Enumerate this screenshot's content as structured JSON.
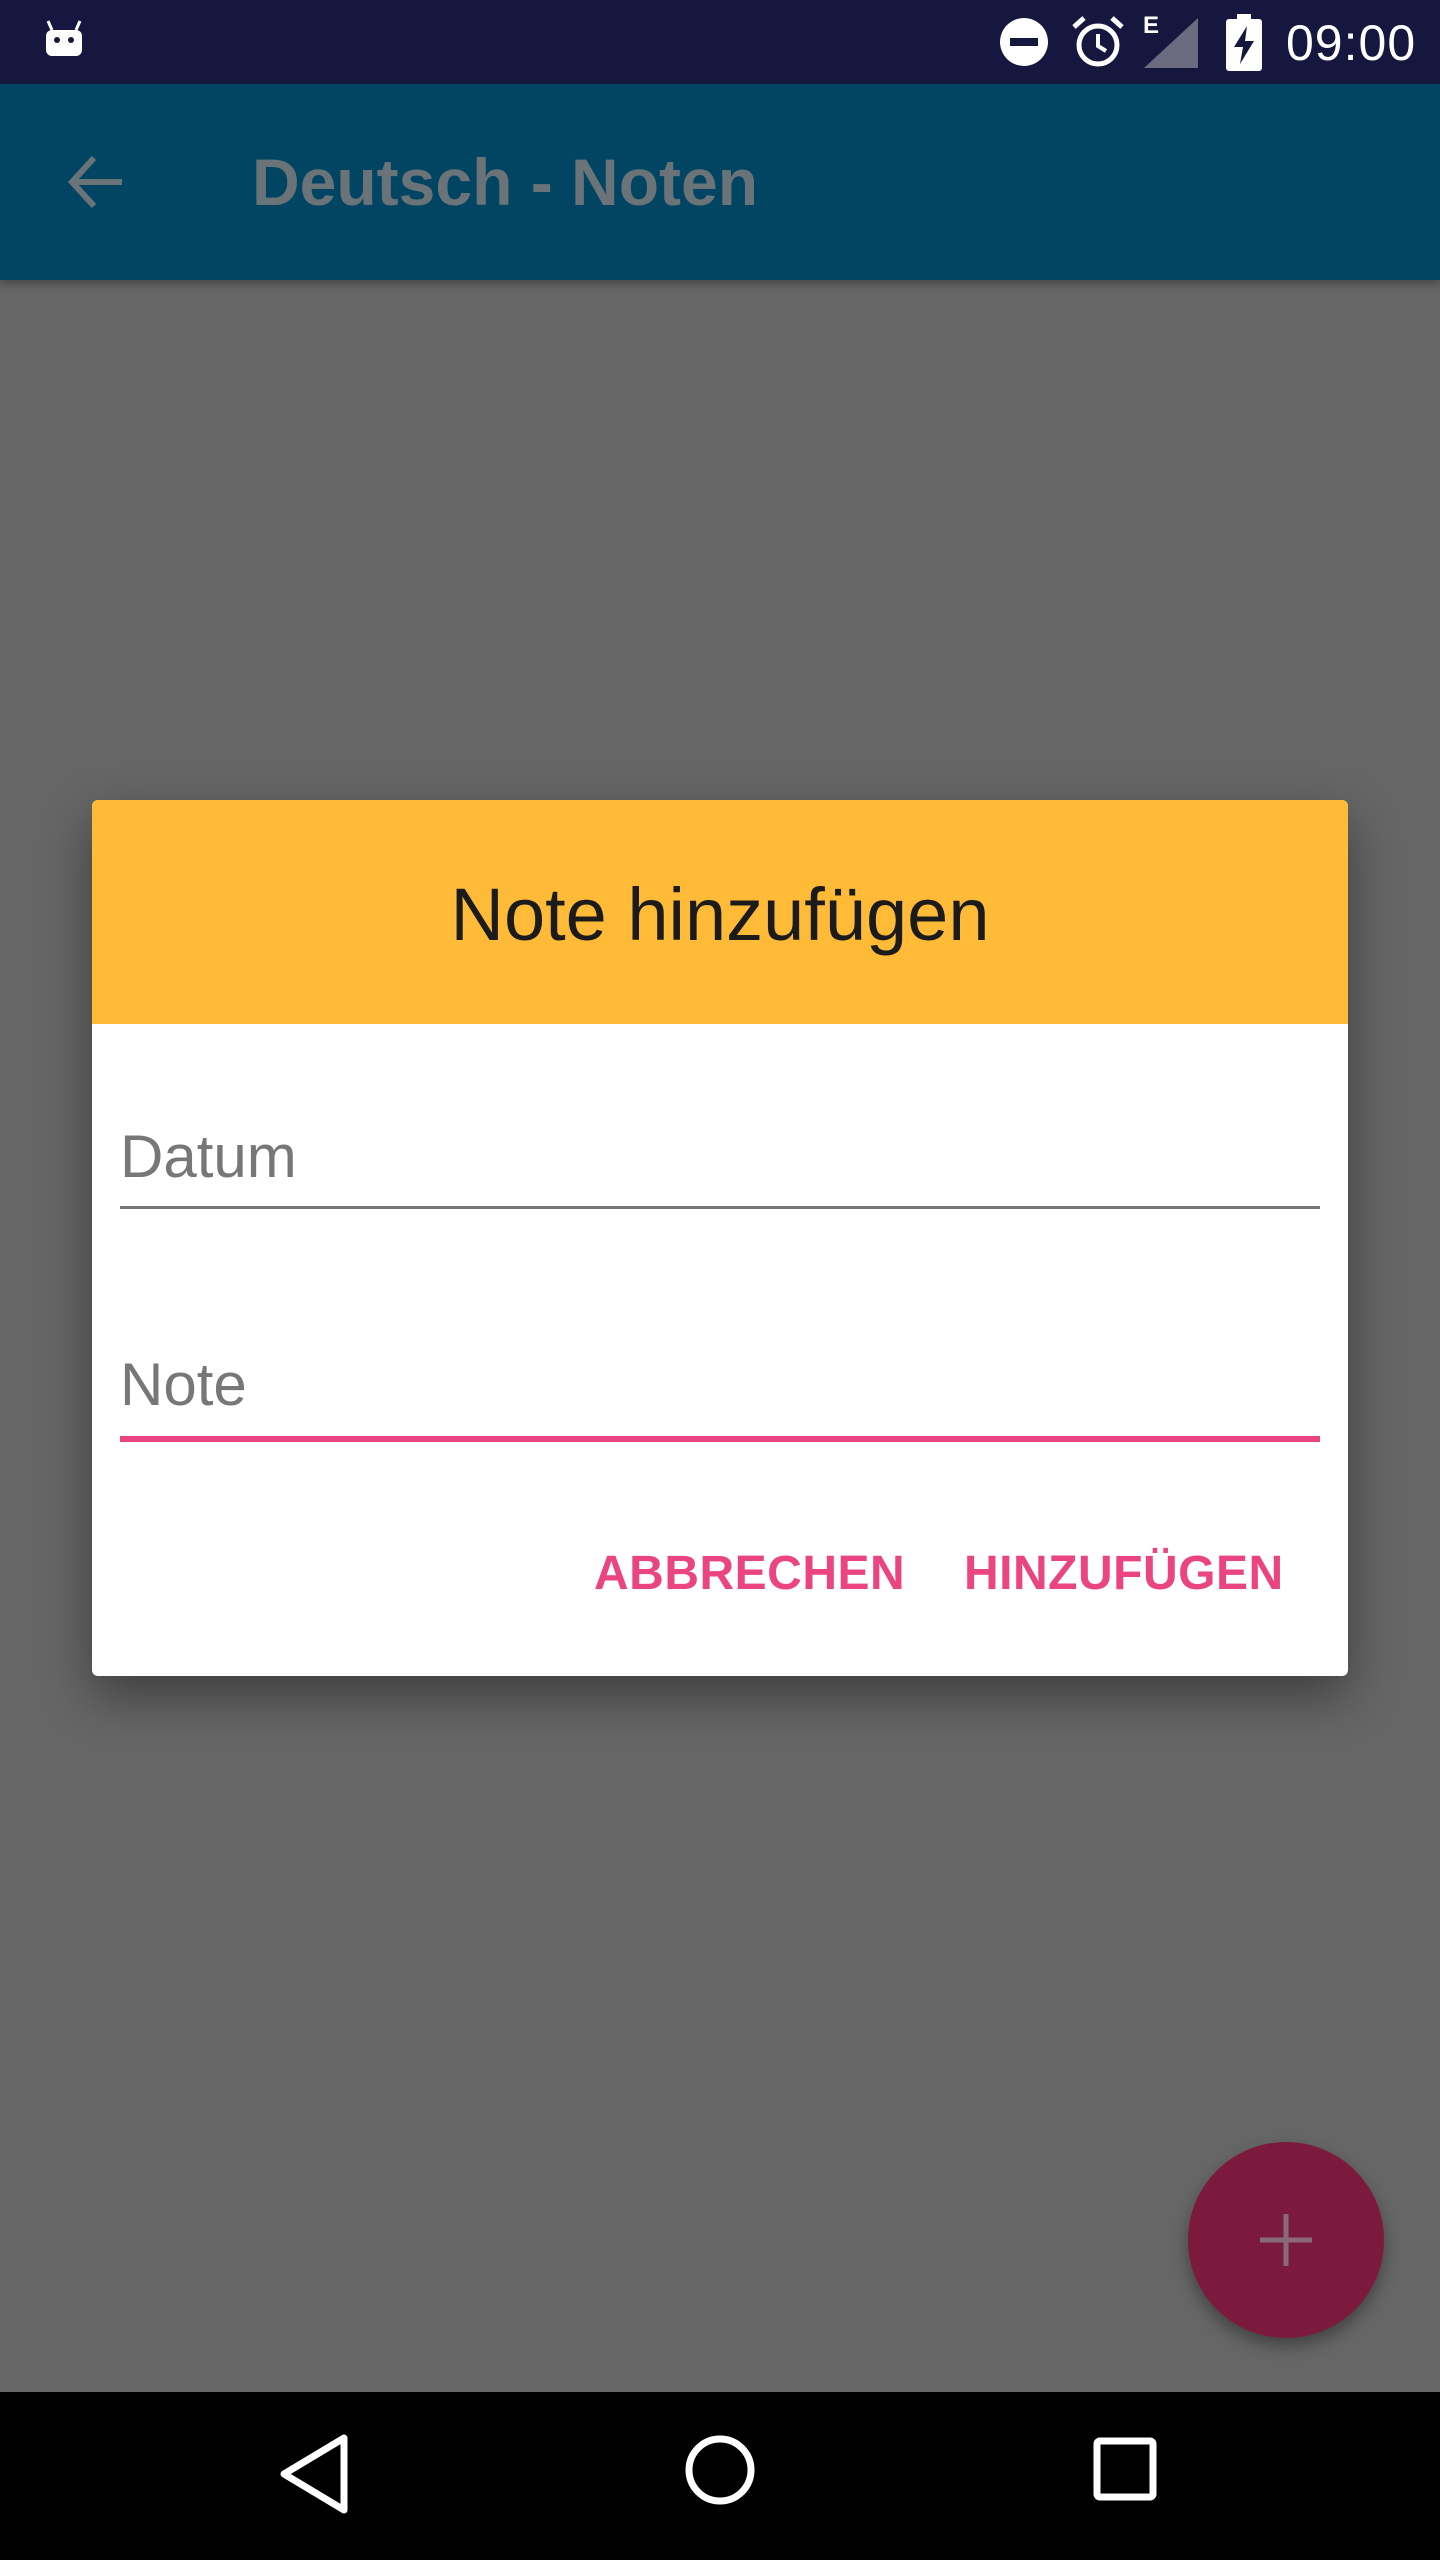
{
  "status_bar": {
    "network_type": "E",
    "time": "09:00",
    "icons": [
      "android-icon",
      "do-not-disturb-icon",
      "alarm-icon",
      "signal-icon",
      "battery-charging-icon"
    ]
  },
  "app_bar": {
    "title": "Deutsch - Noten",
    "back_icon": "arrow-back-icon"
  },
  "dialog": {
    "title": "Note hinzufügen",
    "header_color": "#ffbb37",
    "fields": [
      {
        "placeholder": "Datum",
        "value": "",
        "focused": false
      },
      {
        "placeholder": "Note",
        "value": "",
        "focused": true
      }
    ],
    "buttons": {
      "cancel": "ABBRECHEN",
      "add": "HINZUFÜGEN"
    },
    "accent_color": "#ea4580"
  },
  "fab": {
    "icon": "plus-icon",
    "color": "#7b1a3d"
  },
  "nav_bar": {
    "icons": [
      "nav-back-icon",
      "nav-home-icon",
      "nav-recents-icon"
    ]
  }
}
